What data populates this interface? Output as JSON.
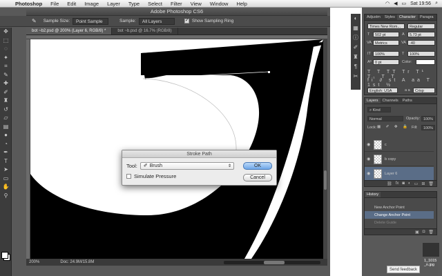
{
  "menubar": {
    "app_name": "Photoshop",
    "items": [
      "File",
      "Edit",
      "Image",
      "Layer",
      "Type",
      "Select",
      "Filter",
      "View",
      "Window",
      "Help"
    ],
    "clock": "Sat 19:56"
  },
  "window": {
    "title": "Adobe Photoshop CS6"
  },
  "options_bar": {
    "sample_size_label": "Sample Size:",
    "sample_size_value": "Point Sample",
    "sample_label": "Sample:",
    "sample_value": "All Layers",
    "show_ring_label": "Show Sampling Ring"
  },
  "doc_tabs": [
    {
      "label": "bot ~b2.psd @ 200% (Layer 6, RGB/8) *",
      "active": true
    },
    {
      "label": "bot ~b.psd @ 16.7% (RGB/8)",
      "active": false
    }
  ],
  "status_bar": {
    "zoom": "200%",
    "doc_size": "Doc: 24.9M/15.8M"
  },
  "dialog": {
    "title": "Stroke Path",
    "tool_label": "Tool:",
    "tool_value": "Brush",
    "simulate_label": "Simulate Pressure",
    "ok_label": "OK",
    "cancel_label": "Cancel"
  },
  "character_panel": {
    "tabs": [
      "Adjustm",
      "Styles",
      "Character",
      "Paragra"
    ],
    "font_family": "Times New Rom...",
    "font_style": "Regular",
    "size": "502 pt",
    "leading": "5.73 pt",
    "kerning": "Metrics",
    "tracking": "-40",
    "vscale": "100%",
    "hscale": "100%",
    "baseline": "0 pt",
    "color_label": "Color:",
    "language": "English: USA",
    "aa_label": "a a",
    "antialias": "Crisp"
  },
  "layers_panel": {
    "tabs": [
      "Layers",
      "Channels",
      "Paths"
    ],
    "filter_label": "Kind",
    "blend_mode": "Normal",
    "opacity_label": "Opacity:",
    "opacity_value": "100%",
    "lock_label": "Lock:",
    "fill_label": "Fill:",
    "fill_value": "100%",
    "layers": [
      {
        "name": "c",
        "selected": false
      },
      {
        "name": "b copy",
        "selected": false
      },
      {
        "name": "Layer 6",
        "selected": true
      }
    ]
  },
  "history_panel": {
    "tab": "History",
    "items": [
      {
        "name": "New Anchor Point",
        "state": "normal"
      },
      {
        "name": "Change Anchor Point",
        "state": "selected"
      },
      {
        "name": "Delete Guide",
        "state": "dim"
      }
    ]
  },
  "desktop": {
    "feedback_label": "Send feedback",
    "file_label": "1_1015\n_n.jpg"
  },
  "colors": {
    "accent": "#5a6d87",
    "ok_button": "#6fa7e8",
    "close": "#ff5f57",
    "minimize": "#febc2e",
    "zoom": "#28c840"
  }
}
